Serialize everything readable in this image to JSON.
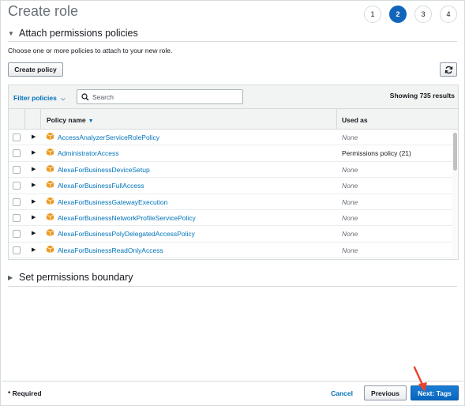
{
  "page": {
    "title": "Create role",
    "steps": [
      "1",
      "2",
      "3",
      "4"
    ],
    "active_step": "2"
  },
  "attach_section": {
    "heading": "Attach permissions policies",
    "description": "Choose one or more policies to attach to your new role.",
    "create_policy_label": "Create policy",
    "refresh_icon": "refresh-icon"
  },
  "filterbar": {
    "filter_label": "Filter policies",
    "search_placeholder": "Search",
    "showing": "Showing 735 results"
  },
  "table": {
    "columns": [
      "Policy name",
      "Used as"
    ],
    "rows": [
      {
        "name": "AccessAnalyzerServiceRolePolicy",
        "used": "None"
      },
      {
        "name": "AdministratorAccess",
        "used": "Permissions policy (21)"
      },
      {
        "name": "AlexaForBusinessDeviceSetup",
        "used": "None"
      },
      {
        "name": "AlexaForBusinessFullAccess",
        "used": "None"
      },
      {
        "name": "AlexaForBusinessGatewayExecution",
        "used": "None"
      },
      {
        "name": "AlexaForBusinessNetworkProfileServicePolicy",
        "used": "None"
      },
      {
        "name": "AlexaForBusinessPolyDelegatedAccessPolicy",
        "used": "None"
      },
      {
        "name": "AlexaForBusinessReadOnlyAccess",
        "used": "None"
      }
    ]
  },
  "boundary_section": {
    "heading": "Set permissions boundary"
  },
  "footer": {
    "required": "* Required",
    "cancel": "Cancel",
    "previous": "Previous",
    "next": "Next: Tags"
  },
  "colors": {
    "accent": "#0073bb",
    "primary_button": "#1166bb",
    "policy_icon": "#ec9a1f",
    "annotation_arrow": "#e8442c"
  }
}
